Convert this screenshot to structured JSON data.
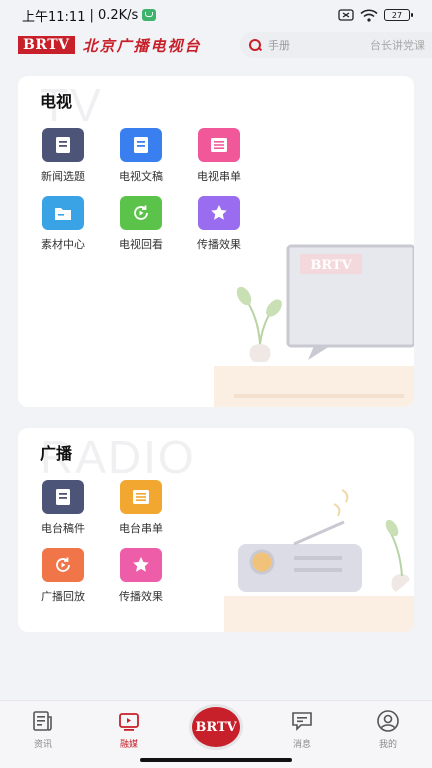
{
  "status_bar": {
    "time": "上午11:11",
    "network_speed": "| 0.2K/s",
    "battery": "27"
  },
  "header": {
    "logo": "BRTV",
    "station_name": "北京广播电视台",
    "search_placeholder": "手册",
    "search_hint": "台长讲党课"
  },
  "tv_section": {
    "title": "电视",
    "watermark": "TV",
    "tv_screen_logo": "BRTV",
    "items": [
      {
        "label": "新闻选题",
        "icon": "document-icon",
        "color": "#4c5578"
      },
      {
        "label": "电视文稿",
        "icon": "document-icon",
        "color": "#3a7ff0"
      },
      {
        "label": "电视串单",
        "icon": "list-icon",
        "color": "#f0589a"
      },
      {
        "label": "素材中心",
        "icon": "folder-icon",
        "color": "#3aa3e6"
      },
      {
        "label": "电视回看",
        "icon": "replay-icon",
        "color": "#5cc34a"
      },
      {
        "label": "传播效果",
        "icon": "star-icon",
        "color": "#9a6cf0"
      }
    ]
  },
  "radio_section": {
    "title": "广播",
    "watermark": "RADIO",
    "items": [
      {
        "label": "电台稿件",
        "icon": "document-icon",
        "color": "#4c5578"
      },
      {
        "label": "电台串单",
        "icon": "list-icon",
        "color": "#f2a830"
      },
      {
        "label": "广播回放",
        "icon": "replay-icon",
        "color": "#f0764a"
      },
      {
        "label": "传播效果",
        "icon": "star-icon",
        "color": "#ee5ea8"
      }
    ]
  },
  "tab_bar": {
    "tabs": [
      {
        "label": "资讯",
        "icon": "news-icon",
        "active": false
      },
      {
        "label": "融媒",
        "icon": "media-icon",
        "active": true
      },
      {
        "label": "消息",
        "icon": "message-icon",
        "active": false
      },
      {
        "label": "我的",
        "icon": "profile-icon",
        "active": false
      }
    ],
    "center_logo": "BRTV"
  },
  "colors": {
    "brand": "#c8202a",
    "background": "#f2f3f6"
  }
}
